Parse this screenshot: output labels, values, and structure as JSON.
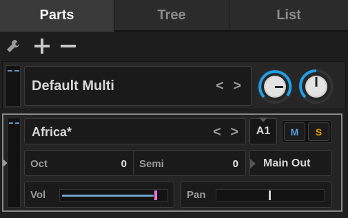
{
  "tabs": [
    {
      "label": "Parts",
      "active": true
    },
    {
      "label": "Tree",
      "active": false
    },
    {
      "label": "List",
      "active": false
    }
  ],
  "toolbar": {
    "settings_icon": "wrench-icon",
    "add_icon": "plus-icon",
    "remove_icon": "minus-icon"
  },
  "multi": {
    "name": "Default Multi",
    "nav_arrows": "< >"
  },
  "part": {
    "name": "Africa*",
    "nav_arrows": "< >",
    "channel": "A1",
    "mute_label": "M",
    "solo_label": "S",
    "oct_label": "Oct",
    "oct_value": "0",
    "semi_label": "Semi",
    "semi_value": "0",
    "output_label": "Main Out",
    "vol_label": "Vol",
    "vol_level": 0.9,
    "pan_label": "Pan",
    "pan_level": 0.5
  },
  "colors": {
    "accent": "#1ea0e6",
    "mute": "#5aa0e0",
    "solo": "#e0a000",
    "vol_marker": "#f070d0",
    "vol_fill": "#6fa0c8"
  }
}
